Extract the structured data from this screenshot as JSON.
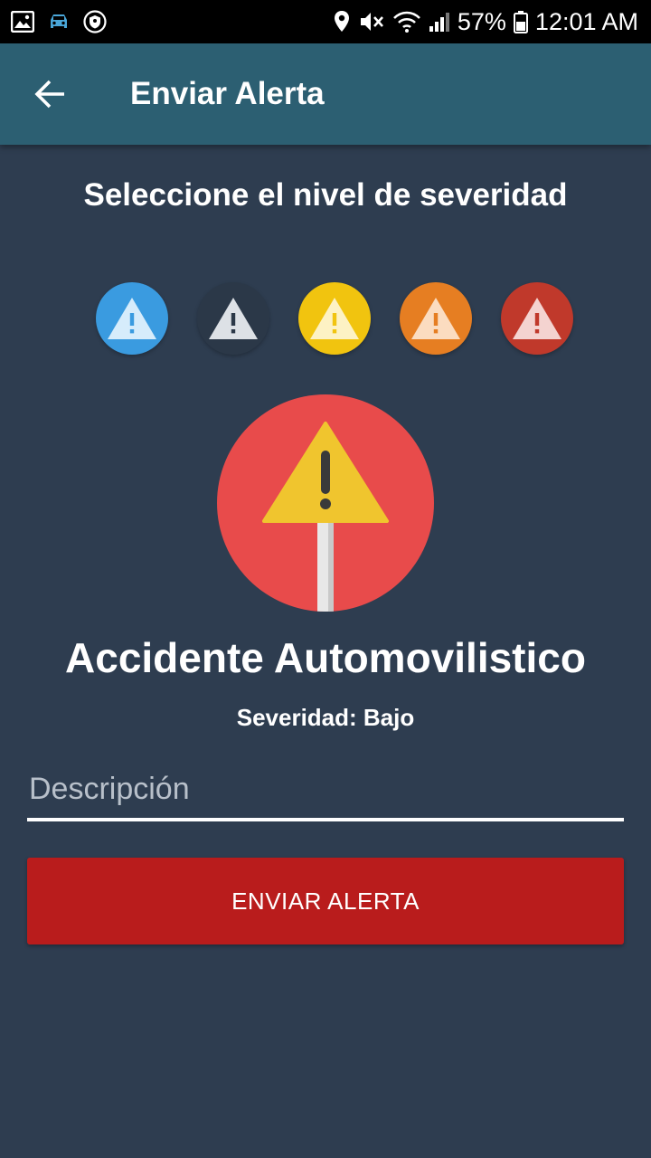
{
  "status_bar": {
    "battery": "57%",
    "time": "12:01 AM",
    "icons": [
      "image-icon",
      "car-icon",
      "shield-icon",
      "location-icon",
      "mute-icon",
      "wifi-icon",
      "signal-icon",
      "battery-icon"
    ]
  },
  "app_bar": {
    "title": "Enviar Alerta",
    "back_icon": "arrow-left-icon",
    "color": "#2c5f72"
  },
  "heading": "Seleccione el nivel de severidad",
  "severity_levels": [
    {
      "color": "#3a9be0",
      "icon": "warning-icon",
      "selected": false
    },
    {
      "color": "#2b3848",
      "icon": "warning-icon",
      "selected": true
    },
    {
      "color": "#f1c40f",
      "icon": "warning-icon",
      "selected": false
    },
    {
      "color": "#e67e22",
      "icon": "warning-icon",
      "selected": false
    },
    {
      "color": "#c0392b",
      "icon": "warning-icon",
      "selected": false
    }
  ],
  "event": {
    "icon": "warning-sign-icon",
    "title": "Accidente Automovilistico",
    "severity_label": "Severidad: Bajo"
  },
  "description": {
    "value": "",
    "placeholder": "Descripción"
  },
  "submit": {
    "label": "ENVIAR ALERTA",
    "color": "#b91c1c"
  },
  "background_color": "#2e3d50"
}
